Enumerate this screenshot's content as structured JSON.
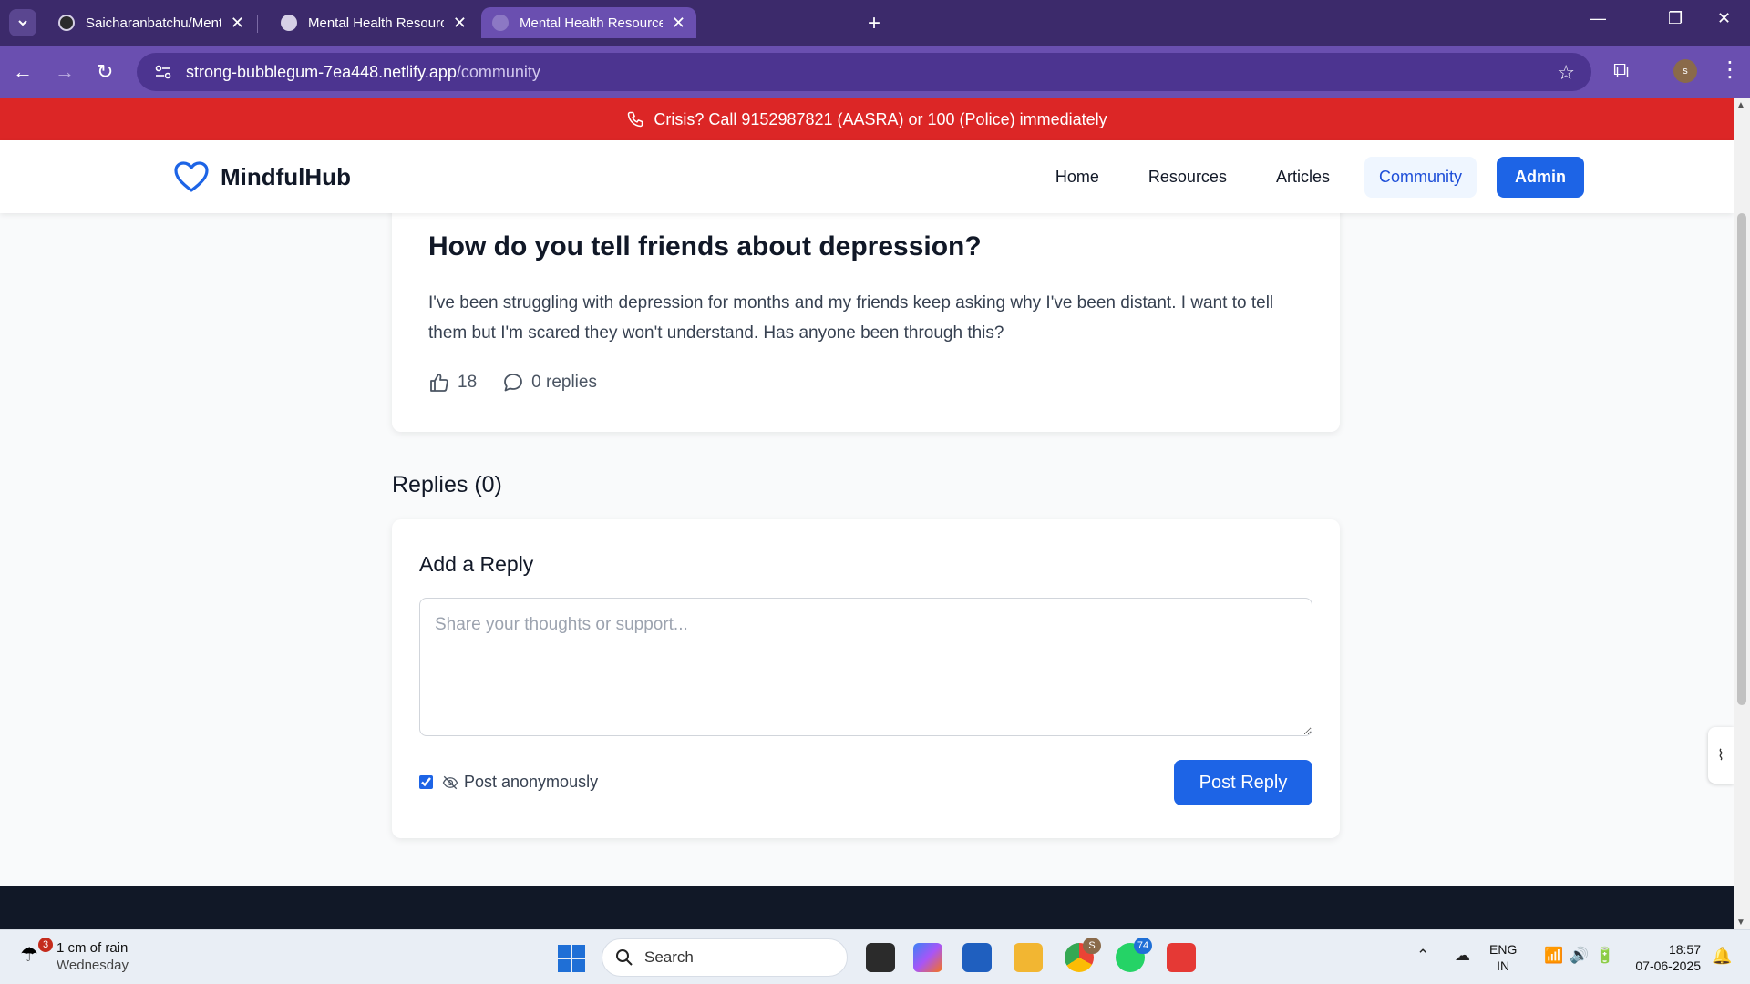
{
  "browser": {
    "tabs": [
      {
        "title": "Saicharanbatchu/Mental-Health"
      },
      {
        "title": "Mental Health Resource Hub - S"
      },
      {
        "title": "Mental Health Resource Hub - S"
      }
    ],
    "url_domain": "strong-bubblegum-7ea448.netlify.app",
    "url_path": "/community",
    "profile_initial": "s"
  },
  "crisis_banner": "Crisis? Call 9152987821 (AASRA) or 100 (Police) immediately",
  "site": {
    "brand": "MindfulHub",
    "nav": {
      "home": "Home",
      "resources": "Resources",
      "articles": "Articles",
      "community": "Community",
      "admin": "Admin"
    }
  },
  "post": {
    "title": "How do you tell friends about depression?",
    "body": "I've been struggling with depression for months and my friends keep asking why I've been distant. I want to tell them but I'm scared they won't understand. Has anyone been through this?",
    "likes": "18",
    "replies_label": "0 replies"
  },
  "replies_heading": "Replies (0)",
  "reply_form": {
    "title": "Add a Reply",
    "placeholder": "Share your thoughts or support...",
    "anonymous_label": "Post anonymously",
    "anonymous_checked": true,
    "submit_label": "Post Reply"
  },
  "taskbar": {
    "weather_badge": "3",
    "weather_line1": "1 cm of rain",
    "weather_line2": "Wednesday",
    "search_label": "Search",
    "chrome_badge": "S",
    "whatsapp_badge": "74",
    "lang_line1": "ENG",
    "lang_line2": "IN",
    "time": "18:57",
    "date": "07-06-2025"
  },
  "colors": {
    "crisis_red": "#dc2626",
    "primary_blue": "#1d64e6",
    "browser_purple": "#6a4fb0"
  }
}
